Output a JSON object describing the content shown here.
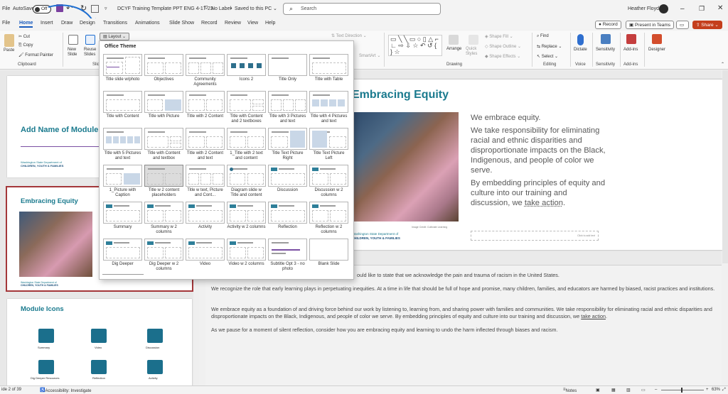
{
  "titlebar": {
    "file_label": "File",
    "autosave_label": "AutoSave",
    "autosave_state": "Off",
    "doc_title": "DCYF Training Template PPT ENG 4-17-23",
    "label_status": "No Label",
    "save_status": "Saved to this PC",
    "search_placeholder": "Search",
    "user_name": "Heather Floyd"
  },
  "tabs": [
    "Home",
    "Insert",
    "Draw",
    "Design",
    "Transitions",
    "Animations",
    "Slide Show",
    "Record",
    "Review",
    "View",
    "Help"
  ],
  "tab_actions": {
    "record": "Record",
    "present": "Present in Teams",
    "share": "Share"
  },
  "ribbon": {
    "paste": "Paste",
    "cut": "Cut",
    "copy": "Copy",
    "format_painter": "Format Painter",
    "clipboard_group": "Clipboard",
    "new_slide": "New Slide",
    "reuse_slides": "Reuse Slides",
    "slides_group": "Slid",
    "layout_button": "Layout",
    "text_direction": "Text Direction",
    "smartart": "SmartArt",
    "arrange": "Arrange",
    "quick_styles": "Quick Styles",
    "shape_fill": "Shape Fill",
    "shape_outline": "Shape Outline",
    "shape_effects": "Shape Effects",
    "drawing_group": "Drawing",
    "find": "Find",
    "replace": "Replace",
    "select": "Select",
    "editing_group": "Editing",
    "dictate": "Dictate",
    "voice_group": "Voice",
    "sensitivity": "Sensitivity",
    "sensitivity_group": "Sensitivity",
    "addins": "Add-ins",
    "addins_group": "Add-ins",
    "designer": "Designer"
  },
  "gallery": {
    "header": "Office Theme",
    "layouts": [
      "Title slide w/photo",
      "Objectives",
      "Community Agreements",
      "Icons 2",
      "Title Only",
      "Title with Table",
      "Title with Content",
      "Title with Picture",
      "Title with 2 Content",
      "Title with Content and 2 textboxes",
      "Title with 3 Pictures and text",
      "Title with 4 Pictures and text",
      "Title with 5 Pictures and text",
      "Title with Content and textbox",
      "Title with 2 Content and text",
      "1_Title with 2 text and content",
      "Title Text Picture Right",
      "Title Text Picture Left",
      "1_Picture with Caption",
      "Title w 2 content placeholders",
      "Title w text, Picture and Cont...",
      "Diagram slide w Title and content",
      "Discussion",
      "Discussion w 2 columns",
      "Summary",
      "Summary w 2 columns",
      "Activity",
      "Activity w 2 columns",
      "Reflection",
      "Reflection w 2 columns",
      "Dig Deeper",
      "Dig Deeper w 2 columns",
      "Video",
      "Video w 2 columns",
      "Subtitle Opt 3 - no photo",
      "Blank Slide"
    ]
  },
  "thumbnails": {
    "slide1_title": "Add Name of Module",
    "slide2_title": "Embracing Equity",
    "slide3_title": "Module Icons",
    "org_line1": "Washington State Department of",
    "org_line2": "CHILDREN, YOUTH & FAMILIES",
    "icon_labels": [
      "Summary",
      "Video",
      "Discussion",
      "Dig Deeper Resources",
      "Reflection",
      "Activity"
    ]
  },
  "slide": {
    "title": "Embracing Equity",
    "p1": "We embrace equity.",
    "p2": "We take responsibility for eliminating racial and ethnic disparities and disproportionate impacts on the Black, Indigenous, and people of color we serve.",
    "p3a": "By embedding principles of equity and culture into our training and discussion, we ",
    "p3b": "take action",
    "p3c": ".",
    "photo_credit": "Image Credit: Cultivate Learning",
    "org_line1": "Washington State Department of",
    "org_line2": "CHILDREN, YOUTH & FAMILIES",
    "click_to_add": "Click to add text"
  },
  "notes": {
    "n1": "ould like to state that we acknowledge the pain and trauma of racism in the United States.",
    "n2": "We recognize the role that early learning plays in perpetuating inequities. At a time in life that should be full of hope and promise, many children, families, and educators are harmed by biased, racist practices and institutions.",
    "n3a": "We embrace equity as a foundation of and driving force behind our work by listening to, learning from, and sharing power with families and communities. We take responsibility for eliminating racial and ethnic disparities and disproportionate impacts on the Black, Indigenous, and people of color we serve. By embedding principles of equity and culture into our training and discussion, we ",
    "n3b": "take action",
    "n3c": ".",
    "n4": "As we pause for a moment of silent reflection, consider how you are embracing equity and learning to undo the harm inflected through biases and racism."
  },
  "status": {
    "slide_count": "ide 2 of 39",
    "accessibility": "Accessibility: Investigate",
    "notes": "Notes",
    "zoom": "63%"
  },
  "colors": {
    "accent": "#185abd",
    "slide_title": "#1a7a8e",
    "selected_thumb": "#a4373a",
    "share": "#c43e1c"
  }
}
